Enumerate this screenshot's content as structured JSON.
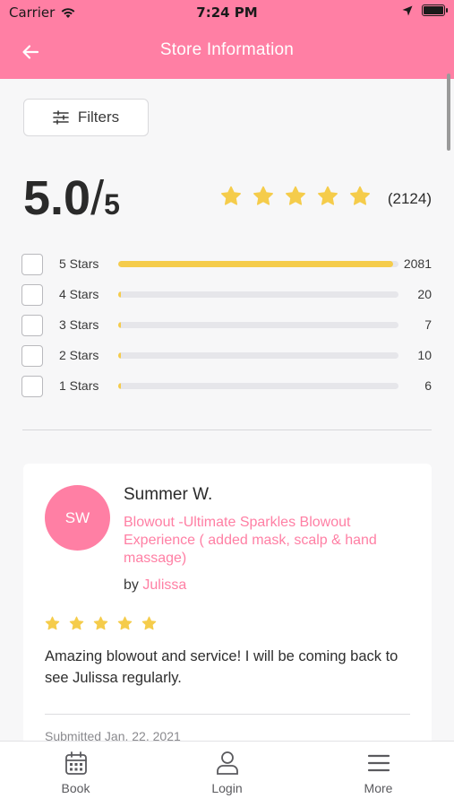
{
  "status_bar": {
    "carrier": "Carrier",
    "time": "7:24 PM"
  },
  "nav": {
    "title": "Store Information",
    "back_icon": "arrow-left-icon"
  },
  "filters": {
    "label": "Filters",
    "icon": "sliders-icon"
  },
  "summary": {
    "rating": "5.0",
    "slash": "/",
    "out_of": "5",
    "stars": 5,
    "review_count": "(2124)"
  },
  "distribution": [
    {
      "label": "5 Stars",
      "count": "2081",
      "fraction": 0.98
    },
    {
      "label": "4 Stars",
      "count": "20",
      "fraction": 0.009
    },
    {
      "label": "3 Stars",
      "count": "7",
      "fraction": 0.003
    },
    {
      "label": "2 Stars",
      "count": "10",
      "fraction": 0.005
    },
    {
      "label": "1 Stars",
      "count": "6",
      "fraction": 0.003
    }
  ],
  "review": {
    "initials": "SW",
    "name": "Summer W.",
    "service": "Blowout -Ultimate Sparkles Blowout Experience ( added mask, scalp & hand massage)",
    "by_prefix": "by",
    "stylist": "Julissa",
    "stars": 5,
    "comment": "Amazing blowout and service! I will be coming back to see Julissa regularly.",
    "submitted": "Submitted Jan. 22, 2021"
  },
  "tabs": [
    {
      "label": "Book",
      "icon": "calendar-icon"
    },
    {
      "label": "Login",
      "icon": "user-icon"
    },
    {
      "label": "More",
      "icon": "menu-icon"
    }
  ],
  "colors": {
    "brand": "#ff7fa4",
    "star": "#f5cc4b",
    "track": "#e6e6ea"
  }
}
